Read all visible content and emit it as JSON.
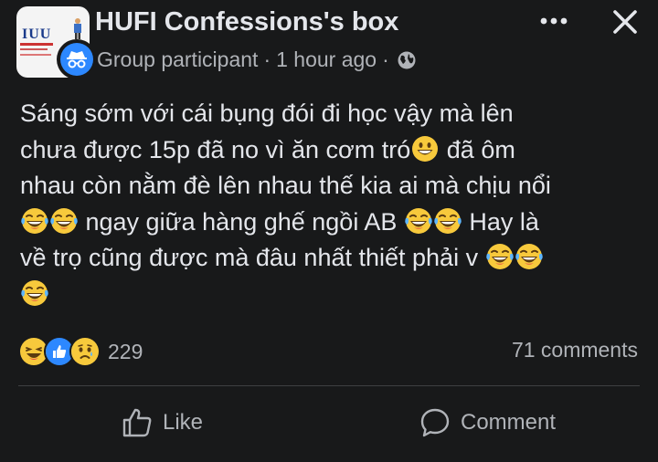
{
  "post": {
    "group_name": "HUFI Confessions's box",
    "author_role": "Group participant",
    "separator": "·",
    "timestamp": "1 hour ago",
    "privacy_icon": "globe-icon",
    "avatar_text": "IUU",
    "body_lines": [
      {
        "text": "Sáng sớm với cái bụng đói đi học vậy mà lên"
      },
      {
        "text": "chưa được 15p đã no vì ăn cơm tró",
        "emoji_after": [
          "grinning"
        ],
        "text_after": " đã ôm"
      },
      {
        "text": "nhau còn nằm đè lên nhau thế kia ai mà chịu nổi"
      },
      {
        "emoji_before": [
          "laughing",
          "laughing"
        ],
        "text": " ngay giữa hàng ghế ngồi AB ",
        "emoji_after": [
          "laughing",
          "laughing"
        ],
        "text_after": " Hay là"
      },
      {
        "text": "về trọ cũng được mà đâu nhất thiết phải v ",
        "emoji_after": [
          "laughing",
          "laughing"
        ]
      },
      {
        "emoji_before": [
          "laughing"
        ]
      }
    ]
  },
  "reactions": {
    "icons": [
      "haha",
      "like",
      "sad"
    ],
    "count": "229"
  },
  "comments_count": "71 comments",
  "actions": {
    "like_label": "Like",
    "comment_label": "Comment"
  },
  "colors": {
    "background": "#18191a",
    "primary_text": "#e4e6eb",
    "secondary_text": "#b0b3b8",
    "accent_blue": "#2d88ff",
    "emoji_yellow": "#f7c93c"
  }
}
